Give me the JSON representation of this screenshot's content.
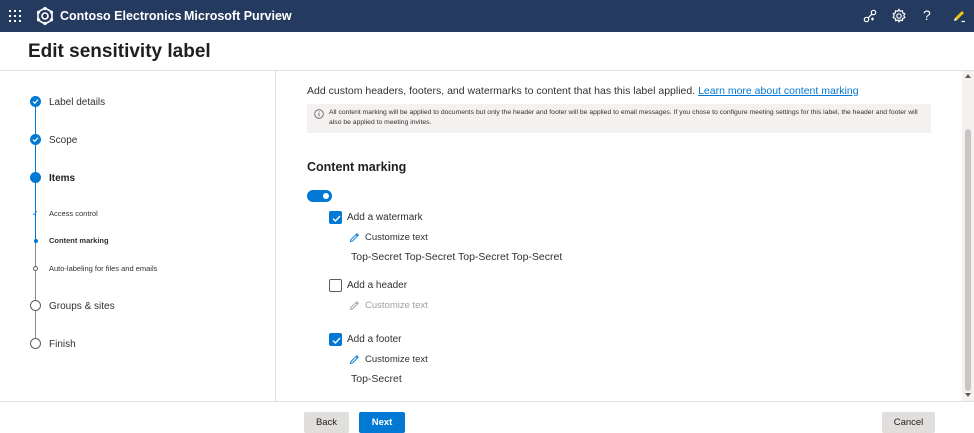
{
  "topbar": {
    "org_name": "Contoso Electronics",
    "app_name": "Microsoft Purview",
    "icons": [
      "app-launcher-icon",
      "connections-icon",
      "settings-icon",
      "help-icon",
      "feedback-icon"
    ],
    "help_glyph": "?",
    "background": "#243a5e"
  },
  "page": {
    "title": "Edit sensitivity label"
  },
  "stepper": {
    "steps": [
      {
        "label": "Label details",
        "state": "done"
      },
      {
        "label": "Scope",
        "state": "done"
      },
      {
        "label": "Items",
        "state": "current"
      },
      {
        "label": "Groups & sites",
        "state": "pending"
      },
      {
        "label": "Finish",
        "state": "pending"
      }
    ],
    "substeps": [
      {
        "label": "Access control",
        "state": "done"
      },
      {
        "label": "Content marking",
        "state": "current"
      },
      {
        "label": "Auto-labeling for files and emails",
        "state": "pending"
      }
    ]
  },
  "main": {
    "description": "Add custom headers, footers, and watermarks to content that has this label applied.",
    "learn_more": "Learn more about content marking",
    "info": "All content marking will be applied to documents but only the header and footer will be applied to email messages. If you chose to configure meeting settings for this label, the header and footer will also be applied to meeting invites.",
    "section_title": "Content marking",
    "toggle_on": true,
    "options": {
      "watermark": {
        "label": "Add a watermark",
        "checked": true,
        "customize": "Customize text",
        "value": "Top-Secret Top-Secret Top-Secret Top-Secret"
      },
      "header": {
        "label": "Add a header",
        "checked": false,
        "customize": "Customize text"
      },
      "footer": {
        "label": "Add a footer",
        "checked": true,
        "customize": "Customize text",
        "value": "Top-Secret"
      }
    }
  },
  "footer": {
    "back": "Back",
    "next": "Next",
    "cancel": "Cancel"
  },
  "colors": {
    "accent": "#0078d4",
    "topbar": "#243a5e"
  }
}
